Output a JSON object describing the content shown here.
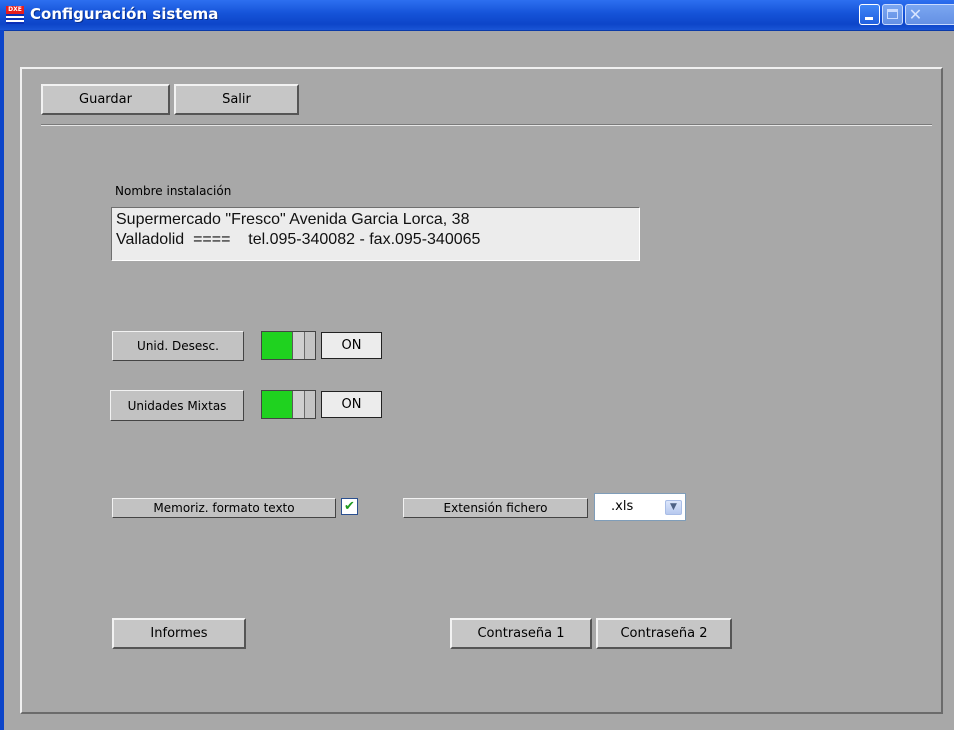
{
  "window": {
    "title": "Configuración sistema",
    "icon_tag": "DXE",
    "controls": [
      "minimize-icon",
      "maximize-icon",
      "close-icon"
    ],
    "accent": "#1553d8"
  },
  "toolbar": {
    "save_label": "Guardar",
    "exit_label": "Salir"
  },
  "installation": {
    "label": "Nombre instalación",
    "line1": "Supermercado \"Fresco\" Avenida Garcia Lorca, 38",
    "line2": "Valladolid  ====    tel.095-340082 - fax.095-340065"
  },
  "options": {
    "unid_desesc_label": "Unid. Desesc.",
    "unid_desesc_state": "ON",
    "unidades_mixtas_label": "Unidades Mixtas",
    "unidades_mixtas_state": "ON",
    "toggle_on_color": "#1fd21f"
  },
  "format": {
    "memoriz_label": "Memoriz. formato texto",
    "memoriz_checked": true,
    "extension_label": "Extensión fichero",
    "extension_value": ".xls"
  },
  "bottom": {
    "reports_label": "Informes",
    "password1_label": "Contraseña 1",
    "password2_label": "Contraseña 2"
  }
}
